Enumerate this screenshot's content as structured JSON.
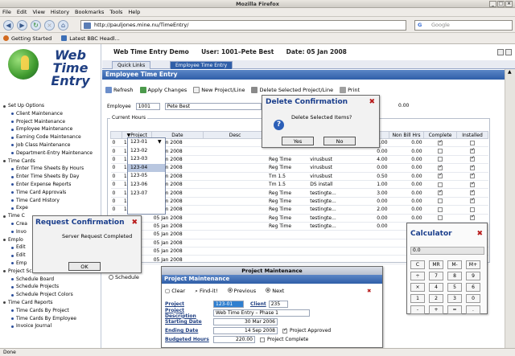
{
  "window": {
    "title": "Mozilla Firefox"
  },
  "menubar": {
    "items": [
      "File",
      "Edit",
      "View",
      "History",
      "Bookmarks",
      "Tools",
      "Help"
    ]
  },
  "nav": {
    "url": "http://pauljones.mine.nu/TimeEntry/",
    "search_placeholder": "Google"
  },
  "bookmarks": {
    "items": [
      "Getting Started",
      "Latest BBC Headl..."
    ]
  },
  "status": {
    "text": "Done"
  },
  "logo": {
    "text": "Web Time Entry"
  },
  "sidebar": {
    "items": [
      {
        "label": "Set Up Options",
        "top": true
      },
      {
        "label": "Client Maintenance",
        "top": false
      },
      {
        "label": "Project  Maintenance",
        "top": false
      },
      {
        "label": "Employee Maintenance",
        "top": false
      },
      {
        "label": "Earning Code Maintenance",
        "top": false
      },
      {
        "label": "Job Class Maintenance",
        "top": false
      },
      {
        "label": "Department-Entry Maintenance",
        "top": false
      },
      {
        "label": "Time Cards",
        "top": true
      },
      {
        "label": "Enter Time Sheets By Hours",
        "top": false
      },
      {
        "label": "Enter Time Sheets By Day",
        "top": false
      },
      {
        "label": "Enter Expense Reports",
        "top": false
      },
      {
        "label": "Time Card Approvals",
        "top": false
      },
      {
        "label": "Time Card History",
        "top": false
      },
      {
        "label": "Expe",
        "top": false
      },
      {
        "label": "Time C",
        "top": true
      },
      {
        "label": "Crea",
        "top": false
      },
      {
        "label": "Invo",
        "top": false
      },
      {
        "label": "Emplo",
        "top": true
      },
      {
        "label": "Edit",
        "top": false
      },
      {
        "label": "Edit",
        "top": false
      },
      {
        "label": "Emp",
        "top": false
      },
      {
        "label": "Project Schedule",
        "top": true
      },
      {
        "label": "Schedule Board",
        "top": false
      },
      {
        "label": "Schedule Projects",
        "top": false
      },
      {
        "label": "Schedule Project Colors",
        "top": false
      },
      {
        "label": "Time Card Reports",
        "top": true
      },
      {
        "label": "Time Cards By Project",
        "top": false
      },
      {
        "label": "Time Cards By Employee",
        "top": false
      },
      {
        "label": "Invoice Journal",
        "top": false
      }
    ]
  },
  "header": {
    "app": "Web Time Entry Demo",
    "user": "User: 1001–Pete Best",
    "date": "Date: 05 Jan 2008"
  },
  "tabs": [
    "Quick Links",
    "Employee Time Entry"
  ],
  "panel": {
    "title": "Employee Time Entry"
  },
  "toolbar": {
    "refresh": "Refresh",
    "apply": "Apply Changes",
    "new": "New Project/Line",
    "delete": "Delete Selected Project/Line",
    "print": "Print"
  },
  "employee": {
    "label": "Employee",
    "id": "1001",
    "name": "Pete Best",
    "total": "0.00"
  },
  "hours": {
    "legend": "Current Hours"
  },
  "grid": {
    "headers": [
      "",
      "▼Project",
      "Date",
      "Desc",
      "",
      "",
      "urs",
      "Non Bill Hrs",
      "Complete",
      "Installed"
    ],
    "rows": [
      {
        "n": "0",
        "project": "123-01",
        "date": "05 Jan 2008",
        "desc": "",
        "ec": "",
        "cl": "",
        "hrs": "0.00",
        "nb": "0.00",
        "complete": true,
        "installed": false
      },
      {
        "n": "0",
        "project": "123-01",
        "date": "05 Jan 2008",
        "desc": "",
        "ec": "",
        "cl": "",
        "hrs": "0.00",
        "nb": "0.00",
        "complete": false,
        "installed": true
      },
      {
        "n": "0",
        "project": "123-02",
        "date": "05 Jan 2008",
        "desc": "",
        "ec": "Reg Time",
        "cl": "virusbust",
        "hrs": "4.00",
        "nb": "0.00",
        "complete": false,
        "installed": true
      },
      {
        "n": "0",
        "project": "123-03",
        "date": "05 Jan 2008",
        "desc": "",
        "ec": "Reg Time",
        "cl": "virusbust",
        "hrs": "0.00",
        "nb": "0.00",
        "complete": true,
        "installed": true
      },
      {
        "n": "0",
        "project": "123-04",
        "date": "05 Jan 2008",
        "desc": "",
        "ec": "Tm 1.5",
        "cl": "virusbust",
        "hrs": "0.50",
        "nb": "0.00",
        "complete": true,
        "installed": true
      },
      {
        "n": "0",
        "project": "123-05",
        "date": "05 Jan 2008",
        "desc": "",
        "ec": "Tm 1.5",
        "cl": "DS install",
        "hrs": "1.00",
        "nb": "0.00",
        "complete": false,
        "installed": true
      },
      {
        "n": "0",
        "project": "123-06",
        "date": "05 Jan 2008",
        "desc": "",
        "ec": "Reg Time",
        "cl": "testingte...",
        "hrs": "3.00",
        "nb": "0.00",
        "complete": true,
        "installed": true
      },
      {
        "n": "0",
        "project": "123-04",
        "date": "05 Jan 2008",
        "desc": "",
        "ec": "Reg Time",
        "cl": "testingte...",
        "hrs": "0.00",
        "nb": "0.00",
        "complete": false,
        "installed": true
      },
      {
        "n": "0",
        "project": "123-04",
        "date": "05 Jan 2008",
        "desc": "",
        "ec": "Reg Time",
        "cl": "testingte...",
        "hrs": "2.00",
        "nb": "0.00",
        "complete": false,
        "installed": false
      },
      {
        "n": "0",
        "project": "123-04",
        "date": "05 Jan 2008",
        "desc": "",
        "ec": "Reg Time",
        "cl": "testingte...",
        "hrs": "0.00",
        "nb": "0.00",
        "complete": false,
        "installed": true
      },
      {
        "n": "0",
        "project": "123-04",
        "date": "05 Jan 2008",
        "desc": "",
        "ec": "Reg Time",
        "cl": "testingte...",
        "hrs": "0.00",
        "nb": "",
        "complete": false,
        "installed": false
      },
      {
        "n": "0",
        "project": "123-04",
        "date": "05 Jan 2008",
        "desc": "",
        "ec": "",
        "cl": "",
        "hrs": "",
        "nb": "",
        "complete": false,
        "installed": false
      },
      {
        "n": "0",
        "project": "123-04",
        "date": "05 Jan 2008",
        "desc": "",
        "ec": "",
        "cl": "",
        "hrs": "",
        "nb": "",
        "complete": false,
        "installed": false
      },
      {
        "n": "0",
        "project": "123-04",
        "date": "05 Jan 2008",
        "desc": "",
        "ec": "",
        "cl": "",
        "hrs": "",
        "nb": "",
        "complete": false,
        "installed": false
      },
      {
        "n": "0",
        "project": "123-04",
        "date": "05 Jan 2008",
        "desc": "",
        "ec": "",
        "cl": "",
        "hrs": "",
        "nb": "",
        "complete": false,
        "installed": false
      }
    ]
  },
  "project_dropdown": {
    "options": [
      "123-01",
      "123-02",
      "123-03",
      "123-04",
      "123-05",
      "123-06",
      "123-07"
    ],
    "selected": "123-04"
  },
  "delete_dialog": {
    "title": "Delete Confirmation",
    "message": "Delete Selected Items?",
    "yes": "Yes",
    "no": "No"
  },
  "request_dialog": {
    "title": "Request Confirmation",
    "message": "Server Request Completed",
    "ok": "OK"
  },
  "calculator": {
    "title": "Calculator",
    "display": "0.0",
    "keys": [
      "C",
      "MR",
      "M-",
      "M+",
      "÷",
      "7",
      "8",
      "9",
      "×",
      "4",
      "5",
      "6",
      "1",
      "2",
      "3",
      "0",
      "-",
      "+",
      "=",
      "."
    ]
  },
  "schedule_hint": {
    "label": "Schedule"
  },
  "project_maintenance": {
    "window_title": "Project Maintenance",
    "panel_title": "Project Maintenance",
    "clear": "Clear",
    "find": "Find-it!",
    "previous": "Previous",
    "next": "Next",
    "project_label": "Project",
    "project": "123-01",
    "client_label": "Client",
    "client": "235",
    "desc_label": "Project Description",
    "desc": "Web Time Entry – Phase 1",
    "start_label": "Starting Date",
    "start": "30 Mar 2006",
    "end_label": "Ending Date",
    "end": "14 Sep 2008",
    "approved": "Project Approved",
    "budget_label": "Budgeted Hours",
    "budget": "220.00",
    "complete": "Project Complete"
  }
}
